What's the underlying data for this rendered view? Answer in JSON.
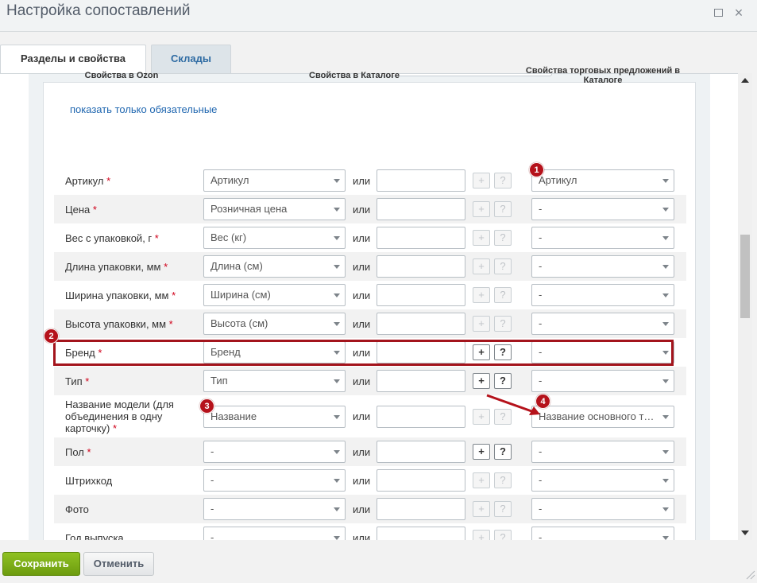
{
  "window": {
    "title": "Настройка сопоставлений",
    "maximize_icon": "maximize-icon",
    "close_icon": "close-icon",
    "close_glyph": "×"
  },
  "tabs": [
    {
      "label": "Разделы и свойства",
      "active": true
    },
    {
      "label": "Склады",
      "active": false
    }
  ],
  "main": {
    "required_link": "показать только обязательные",
    "headers": {
      "ozon": "Свойства в Ozon",
      "catalog": "Свойства в Каталоге",
      "offers": "Свойства торговых предложений в Каталоге"
    },
    "or_label": "или",
    "required_mark": "*",
    "rows": [
      {
        "label": "Артикул",
        "required": true,
        "catalog_value": "Артикул",
        "offer_value": "Артикул",
        "buttons_active": false
      },
      {
        "label": "Цена",
        "required": true,
        "catalog_value": "Розничная цена",
        "offer_value": "-",
        "buttons_active": false
      },
      {
        "label": "Вес с упаковкой, г",
        "required": true,
        "catalog_value": "Вес (кг)",
        "offer_value": "-",
        "buttons_active": false
      },
      {
        "label": "Длина упаковки, мм",
        "required": true,
        "catalog_value": "Длина (см)",
        "offer_value": "-",
        "buttons_active": false
      },
      {
        "label": "Ширина упаковки, мм",
        "required": true,
        "catalog_value": "Ширина (см)",
        "offer_value": "-",
        "buttons_active": false
      },
      {
        "label": "Высота упаковки, мм",
        "required": true,
        "catalog_value": "Высота (см)",
        "offer_value": "-",
        "buttons_active": false
      },
      {
        "label": "Бренд",
        "required": true,
        "catalog_value": "Бренд",
        "offer_value": "-",
        "buttons_active": true
      },
      {
        "label": "Тип",
        "required": true,
        "catalog_value": "Тип",
        "offer_value": "-",
        "buttons_active": true
      },
      {
        "label": "Название модели (для объединения в одну карточку)",
        "required": true,
        "catalog_value": "Название",
        "offer_value": "Название основного т…",
        "buttons_active": false
      },
      {
        "label": "Пол",
        "required": true,
        "catalog_value": "-",
        "offer_value": "-",
        "buttons_active": true
      },
      {
        "label": "Штрихкод",
        "required": false,
        "catalog_value": "-",
        "offer_value": "-",
        "buttons_active": false
      },
      {
        "label": "Фото",
        "required": false,
        "catalog_value": "-",
        "offer_value": "-",
        "buttons_active": false
      },
      {
        "label": "Год выпуска",
        "required": false,
        "catalog_value": "-",
        "offer_value": "-",
        "buttons_active": false
      }
    ],
    "plus_label": "+",
    "help_label": "?"
  },
  "annotations": {
    "badges": [
      "1",
      "2",
      "3",
      "4"
    ],
    "color": "#b5121b"
  },
  "footer": {
    "save_label": "Сохранить",
    "cancel_label": "Отменить"
  },
  "colors": {
    "save_button": "#7cac19",
    "link": "#2067b0",
    "required": "#d0021b",
    "highlight": "#a3141c"
  }
}
